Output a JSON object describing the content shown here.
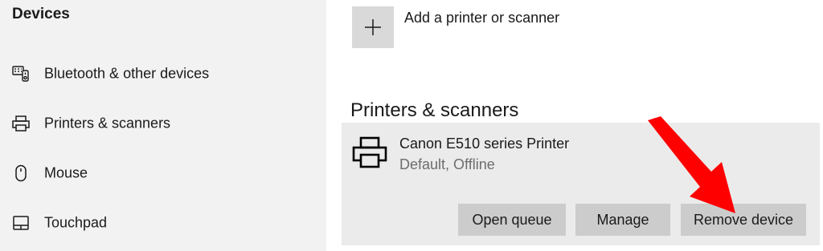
{
  "sidebar": {
    "title": "Devices",
    "items": [
      {
        "label": "Bluetooth & other devices",
        "icon": "bluetooth-devices-icon"
      },
      {
        "label": "Printers & scanners",
        "icon": "printer-icon"
      },
      {
        "label": "Mouse",
        "icon": "mouse-icon"
      },
      {
        "label": "Touchpad",
        "icon": "touchpad-icon"
      }
    ]
  },
  "main": {
    "add_label": "Add a printer or scanner",
    "section_title": "Printers & scanners",
    "device": {
      "name": "Canon E510 series Printer",
      "status": "Default, Offline",
      "buttons": {
        "open_queue": "Open queue",
        "manage": "Manage",
        "remove_device": "Remove device"
      }
    }
  },
  "colors": {
    "sidebar_bg": "#f2f2f2",
    "card_bg": "#ebebeb",
    "button_bg": "#cccccc",
    "arrow": "#ff0000"
  }
}
